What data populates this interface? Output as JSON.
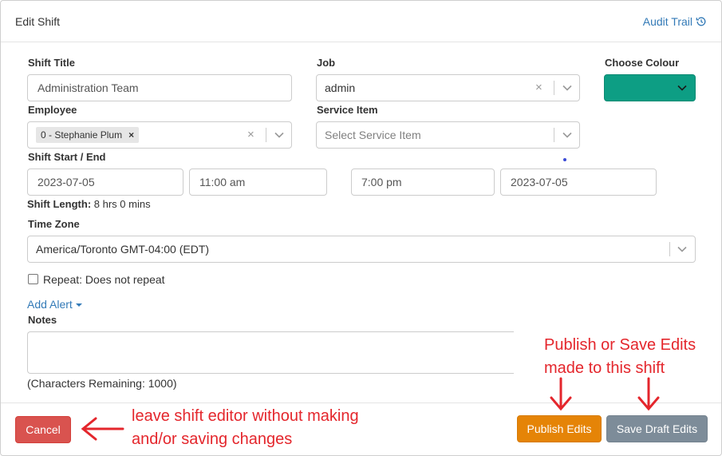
{
  "modal": {
    "title": "Edit Shift",
    "audit_trail_label": "Audit Trail",
    "audit_icon": "history-icon"
  },
  "form": {
    "shift_title": {
      "label": "Shift Title",
      "value": "Administration Team"
    },
    "job": {
      "label": "Job",
      "value": "admin"
    },
    "colour": {
      "label": "Choose Colour",
      "value": "#0d9e84"
    },
    "employee": {
      "label": "Employee",
      "chip": "0 - Stephanie Plum",
      "chip_remove": "×"
    },
    "service_item": {
      "label": "Service Item",
      "placeholder": "Select Service Item"
    },
    "shift_start_end": {
      "label": "Shift Start / End",
      "start_date": "2023-07-05",
      "start_time": "11:00 am",
      "end_time": "7:00 pm",
      "end_date": "2023-07-05"
    },
    "shift_length": {
      "label": "Shift Length:",
      "value": "8 hrs 0 mins"
    },
    "time_zone": {
      "label": "Time Zone",
      "value": "America/Toronto GMT-04:00 (EDT)"
    },
    "repeat": {
      "label": "Repeat: Does not repeat",
      "checked": false
    },
    "add_alert_label": "Add Alert",
    "notes": {
      "label": "Notes",
      "value": "",
      "chars_remaining": "(Characters Remaining: 1000)"
    },
    "clear_symbol": "×"
  },
  "footer": {
    "cancel_label": "Cancel",
    "publish_label": "Publish Edits",
    "save_draft_label": "Save Draft Edits"
  },
  "annotations": {
    "right_line1": "Publish or Save Edits",
    "right_line2": "made to this shift",
    "left_line1": "leave shift editor without making",
    "left_line2": "and/or saving changes",
    "color": "#e4262c"
  }
}
